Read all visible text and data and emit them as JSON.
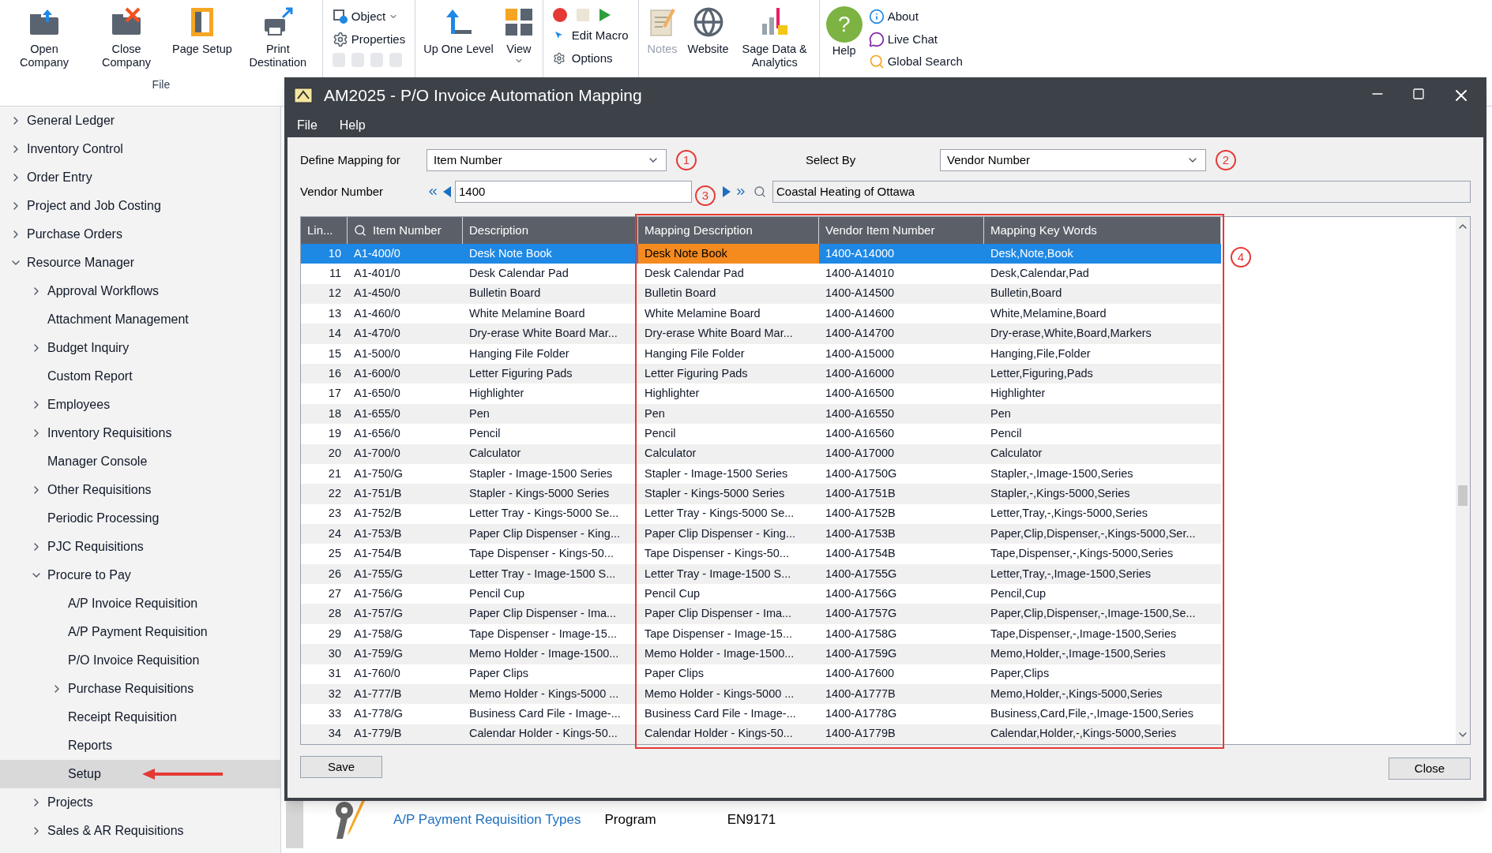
{
  "ribbon": {
    "groups": [
      {
        "kind": "large",
        "label": "File",
        "buttons": [
          {
            "label": "Open Company"
          },
          {
            "label": "Close Company"
          },
          {
            "label": "Page Setup"
          },
          {
            "label": "Print Destination"
          }
        ]
      },
      {
        "kind": "small",
        "items": [
          {
            "label": "Object",
            "dropdown": true
          },
          {
            "label": "Properties",
            "dropdown": false
          }
        ]
      },
      {
        "kind": "large",
        "buttons": [
          {
            "label": "Up One Level",
            "dropdown": false
          },
          {
            "label": "View",
            "dropdown": true
          }
        ]
      },
      {
        "kind": "macro",
        "items": [
          {
            "label": "Edit Macro"
          },
          {
            "label": "Options"
          }
        ]
      },
      {
        "kind": "large",
        "buttons": [
          {
            "label": "Notes",
            "disabled": true
          },
          {
            "label": "Website",
            "disabled": false
          },
          {
            "label": "Sage Data & Analytics",
            "disabled": false
          }
        ]
      },
      {
        "kind": "help",
        "button": {
          "label": "Help",
          "symbol": "?"
        },
        "items": [
          {
            "label": "About"
          },
          {
            "label": "Live Chat"
          },
          {
            "label": "Global Search"
          }
        ]
      }
    ]
  },
  "sidebar": {
    "items": [
      {
        "kind": "group",
        "label": "General Ledger",
        "expanded": false,
        "selected": false
      },
      {
        "kind": "group",
        "label": "Inventory Control",
        "expanded": false,
        "selected": false
      },
      {
        "kind": "group",
        "label": "Order Entry",
        "expanded": false,
        "selected": false
      },
      {
        "kind": "group",
        "label": "Project and Job Costing",
        "expanded": false,
        "selected": false
      },
      {
        "kind": "group",
        "label": "Purchase Orders",
        "expanded": false,
        "selected": false
      },
      {
        "kind": "group",
        "label": "Resource Manager",
        "expanded": true,
        "selected": false,
        "children": [
          {
            "kind": "group",
            "label": "Approval Workflows",
            "expanded": false,
            "selected": false
          },
          {
            "kind": "leaf",
            "label": "Attachment Management",
            "selected": false
          },
          {
            "kind": "group",
            "label": "Budget Inquiry",
            "expanded": false,
            "selected": false
          },
          {
            "kind": "leaf",
            "label": "Custom Report",
            "selected": false
          },
          {
            "kind": "group",
            "label": "Employees",
            "expanded": false,
            "selected": false
          },
          {
            "kind": "group",
            "label": "Inventory Requisitions",
            "expanded": false,
            "selected": false
          },
          {
            "kind": "leaf",
            "label": "Manager Console",
            "selected": false
          },
          {
            "kind": "group",
            "label": "Other Requisitions",
            "expanded": false,
            "selected": false
          },
          {
            "kind": "leaf",
            "label": "Periodic Processing",
            "selected": false
          },
          {
            "kind": "group",
            "label": "PJC Requisitions",
            "expanded": false,
            "selected": false
          },
          {
            "kind": "group",
            "label": "Procure to Pay",
            "expanded": true,
            "selected": false,
            "children": [
              {
                "kind": "leaf",
                "label": "A/P Invoice Requisition",
                "selected": false
              },
              {
                "kind": "leaf",
                "label": "A/P Payment Requisition",
                "selected": false
              },
              {
                "kind": "leaf",
                "label": "P/O Invoice Requisition",
                "selected": false
              },
              {
                "kind": "group",
                "label": "Purchase Requisitions",
                "expanded": false,
                "selected": false
              },
              {
                "kind": "leaf",
                "label": "Receipt Requisition",
                "selected": false
              },
              {
                "kind": "leaf",
                "label": "Reports",
                "selected": false
              },
              {
                "kind": "leaf",
                "label": "Setup",
                "selected": true
              }
            ]
          },
          {
            "kind": "group",
            "label": "Projects",
            "expanded": false,
            "selected": false
          },
          {
            "kind": "group",
            "label": "Sales & AR Requisitions",
            "expanded": false,
            "selected": false
          }
        ]
      }
    ]
  },
  "program_row": {
    "name": "A/P Payment Requisition Types",
    "type": "Program",
    "code": "EN9171"
  },
  "dialog": {
    "title": "AM2025 - P/O Invoice Automation Mapping",
    "menu": [
      "File",
      "Help"
    ],
    "define_mapping": {
      "label": "Define Mapping for",
      "value": "Item Number",
      "marker": "1"
    },
    "select_by": {
      "label": "Select By",
      "value": "Vendor Number",
      "marker": "2"
    },
    "vendor": {
      "label": "Vendor Number",
      "value": "1400",
      "marker": "3",
      "name": "Coastal Heating of Ottawa"
    },
    "table": {
      "marker": "4",
      "columns": [
        "Lin...",
        "Item Number",
        "Description",
        "Mapping Description",
        "Vendor Item Number",
        "Mapping Key Words"
      ],
      "rows": [
        {
          "selected": true,
          "editing": true,
          "cells": [
            "10",
            "A1-400/0",
            "Desk Note Book",
            "Desk Note Book",
            "1400-A14000",
            "Desk,Note,Book"
          ]
        },
        {
          "selected": false,
          "editing": false,
          "cells": [
            "11",
            "A1-401/0",
            "Desk Calendar Pad",
            "Desk Calendar Pad",
            "1400-A14010",
            "Desk,Calendar,Pad"
          ]
        },
        {
          "selected": false,
          "editing": false,
          "cells": [
            "12",
            "A1-450/0",
            "Bulletin Board",
            "Bulletin Board",
            "1400-A14500",
            "Bulletin,Board"
          ]
        },
        {
          "selected": false,
          "editing": false,
          "cells": [
            "13",
            "A1-460/0",
            "White Melamine Board",
            "White Melamine Board",
            "1400-A14600",
            "White,Melamine,Board"
          ]
        },
        {
          "selected": false,
          "editing": false,
          "cells": [
            "14",
            "A1-470/0",
            "Dry-erase White Board Mar...",
            "Dry-erase White Board Mar...",
            "1400-A14700",
            "Dry-erase,White,Board,Markers"
          ]
        },
        {
          "selected": false,
          "editing": false,
          "cells": [
            "15",
            "A1-500/0",
            "Hanging File Folder",
            "Hanging File Folder",
            "1400-A15000",
            "Hanging,File,Folder"
          ]
        },
        {
          "selected": false,
          "editing": false,
          "cells": [
            "16",
            "A1-600/0",
            "Letter Figuring Pads",
            "Letter Figuring Pads",
            "1400-A16000",
            "Letter,Figuring,Pads"
          ]
        },
        {
          "selected": false,
          "editing": false,
          "cells": [
            "17",
            "A1-650/0",
            "Highlighter",
            "Highlighter",
            "1400-A16500",
            "Highlighter"
          ]
        },
        {
          "selected": false,
          "editing": false,
          "cells": [
            "18",
            "A1-655/0",
            "Pen",
            "Pen",
            "1400-A16550",
            "Pen"
          ]
        },
        {
          "selected": false,
          "editing": false,
          "cells": [
            "19",
            "A1-656/0",
            "Pencil",
            "Pencil",
            "1400-A16560",
            "Pencil"
          ]
        },
        {
          "selected": false,
          "editing": false,
          "cells": [
            "20",
            "A1-700/0",
            "Calculator",
            "Calculator",
            "1400-A17000",
            "Calculator"
          ]
        },
        {
          "selected": false,
          "editing": false,
          "cells": [
            "21",
            "A1-750/G",
            "Stapler - Image-1500 Series",
            "Stapler - Image-1500 Series",
            "1400-A1750G",
            "Stapler,-,Image-1500,Series"
          ]
        },
        {
          "selected": false,
          "editing": false,
          "cells": [
            "22",
            "A1-751/B",
            "Stapler - Kings-5000 Series",
            "Stapler - Kings-5000 Series",
            "1400-A1751B",
            "Stapler,-,Kings-5000,Series"
          ]
        },
        {
          "selected": false,
          "editing": false,
          "cells": [
            "23",
            "A1-752/B",
            "Letter Tray - Kings-5000 Se...",
            "Letter Tray - Kings-5000 Se...",
            "1400-A1752B",
            "Letter,Tray,-,Kings-5000,Series"
          ]
        },
        {
          "selected": false,
          "editing": false,
          "cells": [
            "24",
            "A1-753/B",
            "Paper Clip Dispenser - King...",
            "Paper Clip Dispenser - King...",
            "1400-A1753B",
            "Paper,Clip,Dispenser,-,Kings-5000,Ser..."
          ]
        },
        {
          "selected": false,
          "editing": false,
          "cells": [
            "25",
            "A1-754/B",
            "Tape Dispenser - Kings-50...",
            "Tape Dispenser - Kings-50...",
            "1400-A1754B",
            "Tape,Dispenser,-,Kings-5000,Series"
          ]
        },
        {
          "selected": false,
          "editing": false,
          "cells": [
            "26",
            "A1-755/G",
            "Letter Tray - Image-1500 S...",
            "Letter Tray - Image-1500 S...",
            "1400-A1755G",
            "Letter,Tray,-,Image-1500,Series"
          ]
        },
        {
          "selected": false,
          "editing": false,
          "cells": [
            "27",
            "A1-756/G",
            "Pencil Cup",
            "Pencil Cup",
            "1400-A1756G",
            "Pencil,Cup"
          ]
        },
        {
          "selected": false,
          "editing": false,
          "cells": [
            "28",
            "A1-757/G",
            "Paper Clip Dispenser - Ima...",
            "Paper Clip Dispenser - Ima...",
            "1400-A1757G",
            "Paper,Clip,Dispenser,-,Image-1500,Se..."
          ]
        },
        {
          "selected": false,
          "editing": false,
          "cells": [
            "29",
            "A1-758/G",
            "Tape Dispenser - Image-15...",
            "Tape Dispenser - Image-15...",
            "1400-A1758G",
            "Tape,Dispenser,-,Image-1500,Series"
          ]
        },
        {
          "selected": false,
          "editing": false,
          "cells": [
            "30",
            "A1-759/G",
            "Memo Holder - Image-1500...",
            "Memo Holder - Image-1500...",
            "1400-A1759G",
            "Memo,Holder,-,Image-1500,Series"
          ]
        },
        {
          "selected": false,
          "editing": false,
          "cells": [
            "31",
            "A1-760/0",
            "Paper Clips",
            "Paper Clips",
            "1400-A17600",
            "Paper,Clips"
          ]
        },
        {
          "selected": false,
          "editing": false,
          "cells": [
            "32",
            "A1-777/B",
            "Memo Holder - Kings-5000 ...",
            "Memo Holder - Kings-5000 ...",
            "1400-A1777B",
            "Memo,Holder,-,Kings-5000,Series"
          ]
        },
        {
          "selected": false,
          "editing": false,
          "cells": [
            "33",
            "A1-778/G",
            "Business Card File - Image-...",
            "Business Card File - Image-...",
            "1400-A1778G",
            "Business,Card,File,-,Image-1500,Series"
          ]
        },
        {
          "selected": false,
          "editing": false,
          "cells": [
            "34",
            "A1-779/B",
            "Calendar Holder - Kings-50...",
            "Calendar Holder - Kings-50...",
            "1400-A1779B",
            "Calendar,Holder,-,Kings-5000,Series"
          ]
        }
      ]
    },
    "buttons": [
      {
        "kind": "save",
        "label": "Save"
      },
      {
        "kind": "close",
        "label": "Close"
      }
    ]
  }
}
